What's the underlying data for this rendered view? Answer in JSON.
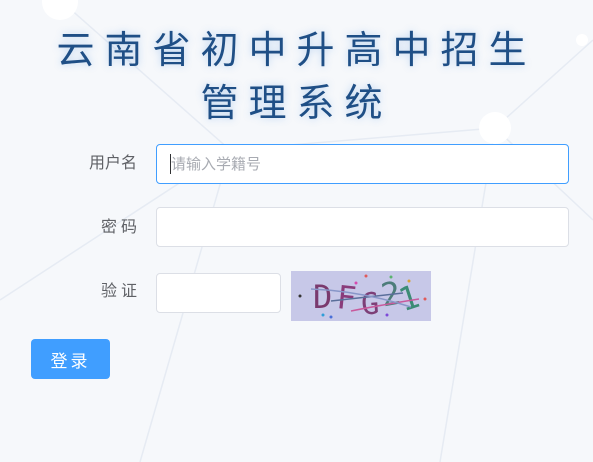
{
  "page": {
    "title_line1": "云南省初中升高中招生",
    "title_line2": "管理系统"
  },
  "login_form": {
    "username_label": "用户名",
    "username_placeholder": "请输入学籍号",
    "password_label": "密码",
    "captcha_label": "验证",
    "captcha_text": "DFG21",
    "login_button_label": "登录"
  },
  "colors": {
    "title": "#1f4f86",
    "accent": "#409eff",
    "background": "#f6f8fb",
    "captcha_background": "#c7c8e8"
  }
}
